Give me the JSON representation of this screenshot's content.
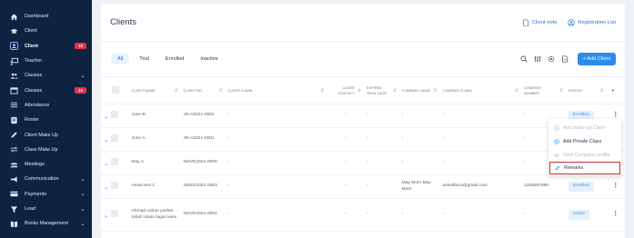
{
  "sidebar": {
    "items": [
      {
        "label": "Dashboard",
        "icon": "home-icon"
      },
      {
        "label": "Client",
        "icon": "graduation-cap-icon"
      },
      {
        "label": "Client",
        "icon": "user-icon",
        "active": true,
        "badge": "10"
      },
      {
        "label": "Teacher",
        "icon": "teacher-board-icon"
      },
      {
        "label": "Classes",
        "icon": "users-icon",
        "caret": true
      },
      {
        "label": "Classes",
        "icon": "calendar-icon",
        "badge": "10"
      },
      {
        "label": "Attendance",
        "icon": "list-icon"
      },
      {
        "label": "Roster",
        "icon": "roster-icon"
      },
      {
        "label": "Client Make Up",
        "icon": "pencil-icon"
      },
      {
        "label": "Class Make Up",
        "icon": "exchange-icon"
      },
      {
        "label": "Meetings",
        "icon": "meetings-icon"
      },
      {
        "label": "Communication",
        "icon": "megaphone-icon",
        "caret": true
      },
      {
        "label": "Payments",
        "icon": "card-icon",
        "caret": true
      },
      {
        "label": "Lead",
        "icon": "filter-icon",
        "caret": true
      },
      {
        "label": "Books Management",
        "icon": "book-icon",
        "caret": true
      }
    ]
  },
  "header": {
    "title": "Clients",
    "client_note": "Client note",
    "registration_list": "Registration List"
  },
  "tabs": [
    {
      "label": "All",
      "active": true
    },
    {
      "label": "Trial"
    },
    {
      "label": "Enrolled"
    },
    {
      "label": "Inactive"
    }
  ],
  "toolbar": {
    "add_client": "+ Add Client"
  },
  "table": {
    "columns": {
      "name": "Client Name",
      "no": "Client No.",
      "email": "Client E-Mail",
      "contact": "Client Contact",
      "expired": "Expired Trial Date",
      "company": "Company Name",
      "company_email": "Company E-Mail",
      "company_number": "Company Number",
      "status": "Status"
    },
    "rows": [
      {
        "name": "June B",
        "no": "JN-A2021-0001",
        "email": "-",
        "contact": "-",
        "expired": "-",
        "company": "-",
        "company_email": "-",
        "company_number": "-",
        "status": "Enrolled"
      },
      {
        "name": "June A",
        "no": "JN-A2021-0001",
        "email": "-",
        "contact": "-",
        "expired": "-",
        "company": "-",
        "company_email": "-",
        "company_number": "-",
        "status": ""
      },
      {
        "name": "May A",
        "no": "NOVE2021-0005",
        "email": "-",
        "contact": "-",
        "expired": "-",
        "company": "-",
        "company_email": "-",
        "company_number": "-",
        "status": ""
      },
      {
        "name": "Anisa test 1",
        "no": "SENG2021-0003",
        "email": "-",
        "contact": "-",
        "expired": "-",
        "company": "May Mom May Mom",
        "company_email": "anisaflavo@gmail.com",
        "company_number": "1258567890",
        "status": "Enrolled"
      },
      {
        "name": "Ahmad subari yasfan tobah tolala lagas kara",
        "no": "NOVE2021-0004",
        "email": "-",
        "contact": "-",
        "expired": "-",
        "company": "-",
        "company_email": "-",
        "company_number": "-",
        "status": "Active"
      }
    ]
  },
  "row_menu": {
    "items": [
      {
        "label": "Add make-up Class",
        "icon": "plus-circle-icon",
        "disabled": true
      },
      {
        "label": "Add Private Class",
        "icon": "plus-circle-icon",
        "disabled": false
      },
      {
        "label": "View Company profile",
        "icon": "eye-icon",
        "disabled": true
      },
      {
        "label": "Remarks",
        "icon": "edit-icon",
        "disabled": false,
        "highlighted": true
      }
    ]
  }
}
